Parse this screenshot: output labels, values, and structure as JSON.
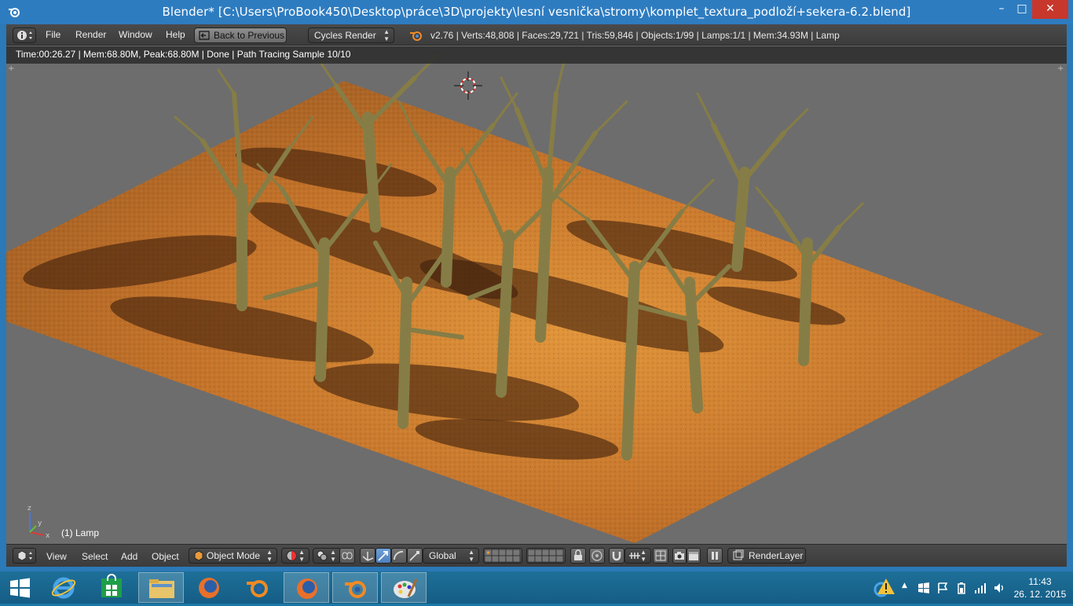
{
  "window": {
    "title": "Blender* [C:\\Users\\ProBook450\\Desktop\\práce\\3D\\projekty\\lesní vesnička\\stromy\\komplet_textura_podloží+sekera-6.2.blend]",
    "minimize": "–",
    "maximize": "□",
    "close": "✕"
  },
  "info_header": {
    "menus": [
      "File",
      "Render",
      "Window",
      "Help"
    ],
    "back_button": "Back to Previous",
    "render_engine": "Cycles Render",
    "stats": "v2.76 | Verts:48,808 | Faces:29,721 | Tris:59,846 | Objects:1/99 | Lamps:1/1 | Mem:34.93M | Lamp"
  },
  "viewport": {
    "render_status": "Time:00:26.27 | Mem:68.80M, Peak:68.80M | Done | Path Tracing Sample 10/10",
    "object_label": "(1) Lamp",
    "axis_labels": {
      "x": "x",
      "y": "y",
      "z": "z"
    }
  },
  "bottom_header": {
    "menus": [
      "View",
      "Select",
      "Add",
      "Object"
    ],
    "mode": "Object Mode",
    "orientation": "Global",
    "render_layer": "RenderLayer"
  },
  "taskbar": {
    "apps": [
      "internet-explorer",
      "windows-store",
      "file-explorer",
      "firefox",
      "blender",
      "firefox",
      "blender",
      "paint"
    ],
    "clock_time": "11:43",
    "clock_date": "26. 12. 2015"
  },
  "colors": {
    "titlebar": "#2e7cc0",
    "close": "#c7372c",
    "viewport_bg": "#6d6d6d",
    "ground": "#c8782a",
    "tree": "#8f8750"
  }
}
